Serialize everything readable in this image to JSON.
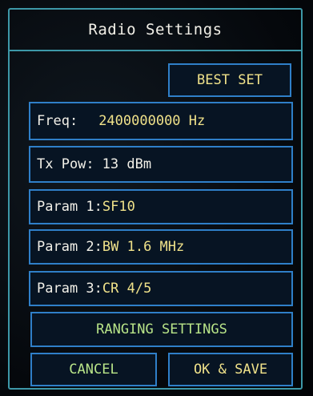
{
  "header": {
    "title": "Radio Settings"
  },
  "buttons": {
    "best_set": "BEST SET",
    "ranging_settings": "RANGING SETTINGS",
    "cancel": "CANCEL",
    "ok_save": "OK & SAVE"
  },
  "fields": {
    "freq": {
      "label": "Freq:",
      "value": "2400000000 Hz"
    },
    "tx_pow": {
      "label": "Tx Pow:",
      "value": "13 dBm"
    },
    "param1": {
      "label": "Param 1:",
      "value": "SF10"
    },
    "param2": {
      "label": "Param 2:",
      "value": "BW 1.6 MHz"
    },
    "param3": {
      "label": "Param 3:",
      "value": "CR 4/5"
    }
  },
  "colors": {
    "frame": "#3d98a8",
    "button_border": "#2f7fc8",
    "label_text": "#f2f0e8",
    "value_text": "#f0e28a",
    "green_text": "#b8e488",
    "background": "#05080c"
  }
}
